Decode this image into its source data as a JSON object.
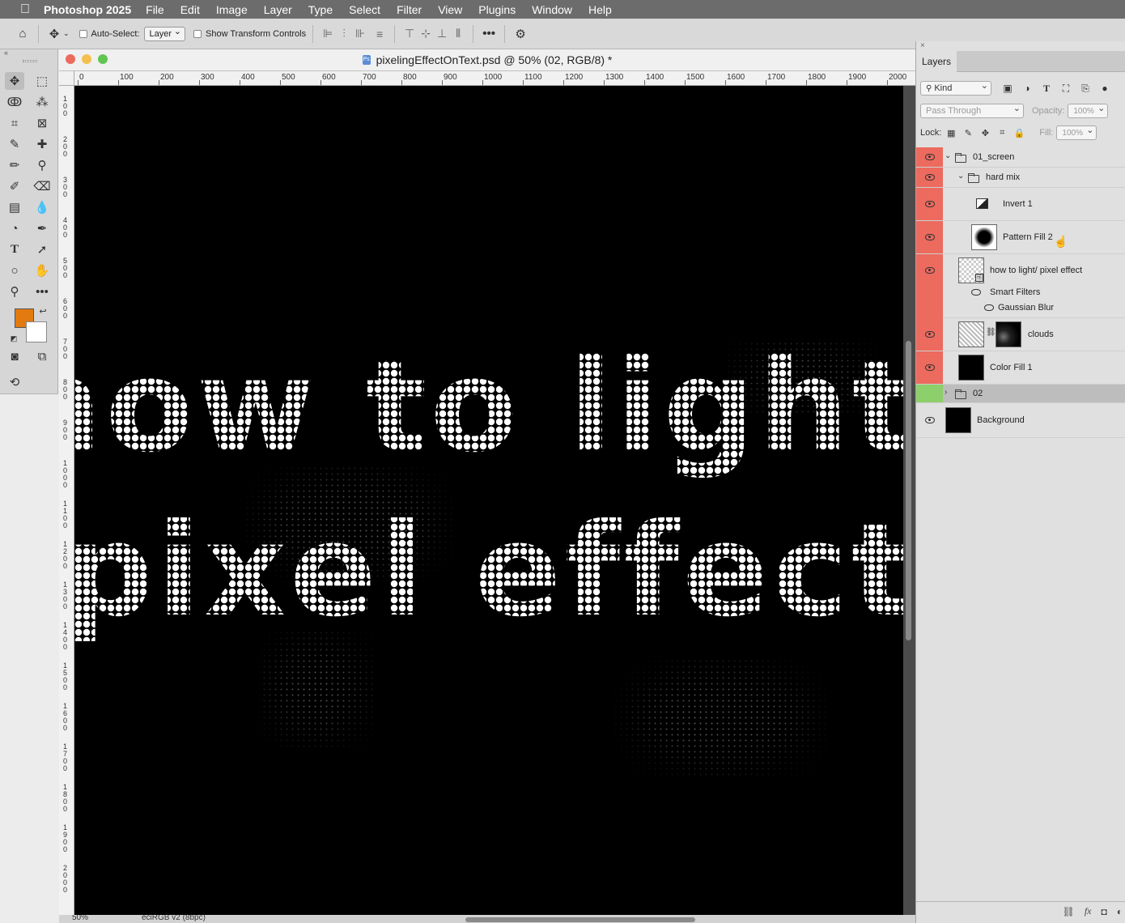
{
  "menubar": {
    "app_name": "Photoshop 2025",
    "items": [
      "File",
      "Edit",
      "Image",
      "Layer",
      "Type",
      "Select",
      "Filter",
      "View",
      "Plugins",
      "Window",
      "Help"
    ]
  },
  "options_bar": {
    "auto_select_label": "Auto-Select:",
    "auto_select_value": "Layer",
    "show_transform_label": "Show Transform Controls",
    "more_icon": "ellipsis-icon",
    "settings_icon": "gear-icon"
  },
  "toolbar": {
    "collapse_label": "«",
    "tools": [
      "move-tool",
      "marquee-tool",
      "lasso-tool",
      "magic-wand-tool",
      "crop-tool",
      "frame-tool",
      "eyedropper-tool",
      "healing-brush-tool",
      "brush-tool",
      "clone-stamp-tool",
      "history-brush-tool",
      "eraser-tool",
      "gradient-tool",
      "blur-tool",
      "dodge-tool",
      "pen-tool",
      "type-tool",
      "path-selection-tool",
      "ellipse-tool",
      "hand-tool",
      "zoom-tool",
      "more-tools",
      "quick-mask",
      "screen-mode",
      "generative-tool"
    ],
    "foreground_color": "#e37a0f",
    "background_color": "#ffffff"
  },
  "document": {
    "title": "pixelingEffectOnText.psd @ 50% (02, RGB/8) *",
    "ruler_top": [
      "0",
      "100",
      "200",
      "300",
      "400",
      "500",
      "600",
      "700",
      "800",
      "900",
      "1000",
      "1100",
      "1200",
      "1300",
      "1400",
      "1500",
      "1600",
      "1700",
      "1800",
      "1900",
      "2000"
    ],
    "ruler_left": [
      "1 0 0",
      "2 0 0",
      "3 0 0",
      "4 0 0",
      "5 0 0",
      "6 0 0",
      "7 0 0",
      "8 0 0",
      "9 0 0",
      "1 0 0 0",
      "1 1 0 0",
      "1 2 0 0",
      "1 3 0 0",
      "1 4 0 0",
      "1 5 0 0",
      "1 6 0 0",
      "1 7 0 0",
      "1 8 0 0",
      "1 9 0 0",
      "2 0 0 0"
    ],
    "canvas_text_line1": "how to light/",
    "canvas_text_line2": "pixel effect",
    "canvas_bg": "#000000",
    "zoom_status": "50%",
    "profile_status": "eciRGB v2 (8bpc)"
  },
  "layers_panel": {
    "tab_label": "Layers",
    "filter_kind": "Kind",
    "blend_mode": "Pass Through",
    "opacity_label": "Opacity:",
    "opacity_value": "100%",
    "lock_label": "Lock:",
    "fill_label": "Fill:",
    "fill_value": "100%",
    "layers": [
      {
        "name": "01_screen",
        "type": "group",
        "visible": true,
        "color": "red"
      },
      {
        "name": "hard mix",
        "type": "group",
        "visible": true,
        "color": "red"
      },
      {
        "name": "Invert 1",
        "type": "adjustment",
        "visible": true,
        "color": "red"
      },
      {
        "name": "Pattern Fill 2",
        "type": "fill",
        "visible": true,
        "color": "red"
      },
      {
        "name": "how to light/ pixel effect",
        "type": "smart-object",
        "visible": true,
        "color": "red",
        "smart_filters_label": "Smart Filters",
        "filters": [
          "Gaussian Blur"
        ]
      },
      {
        "name": "clouds",
        "type": "masked",
        "visible": true,
        "color": "red"
      },
      {
        "name": "Color Fill 1",
        "type": "fill",
        "visible": true,
        "color": "red"
      },
      {
        "name": "02",
        "type": "group",
        "visible": false,
        "color": "green",
        "selected": true
      },
      {
        "name": "Background",
        "type": "background",
        "visible": true,
        "color": "none"
      }
    ]
  }
}
